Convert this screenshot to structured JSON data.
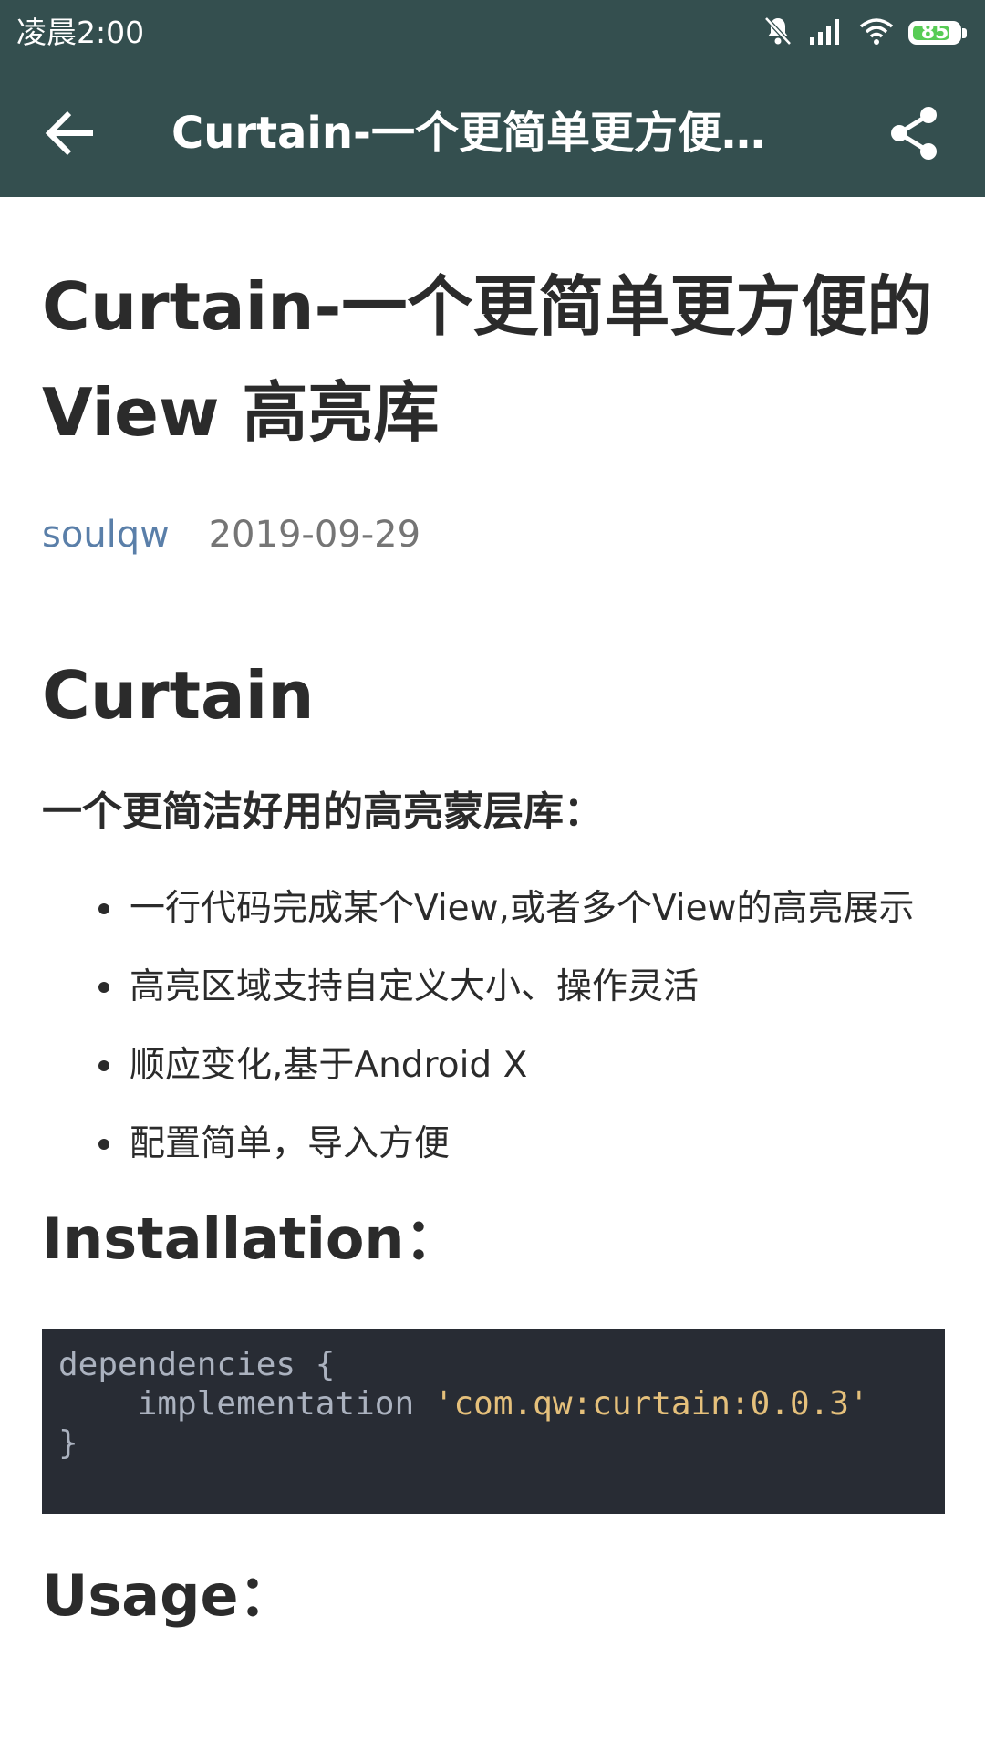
{
  "status_bar": {
    "time": "凌晨2:00",
    "battery_level": 85,
    "battery_text": "85",
    "icons": [
      "mute-bell-icon",
      "signal-icon",
      "wifi-icon",
      "battery-icon"
    ]
  },
  "app_bar": {
    "title": "Curtain-一个更简单更方便…",
    "background_color": "#344f4f",
    "icons": [
      "back-arrow-icon",
      "share-icon"
    ]
  },
  "article": {
    "title": "Curtain-一个更简单更方便的View 高亮库",
    "author": "soulqw",
    "date": "2019-09-29",
    "heading": "Curtain",
    "subheading": "一个更简洁好用的高亮蒙层库：",
    "features": [
      "一行代码完成某个View,或者多个View的高亮展示",
      "高亮区域支持自定义大小、操作灵活",
      "顺应变化,基于Android X",
      "配置简单，导入方便"
    ],
    "installation_heading": "Installation：",
    "code": {
      "line1": "dependencies {",
      "line2_keyword": "    implementation ",
      "line2_string": "'com.qw:curtain:0.0.3'",
      "line3": "}"
    },
    "usage_heading": "Usage："
  },
  "colors": {
    "author_link": "#5a7fa9",
    "text": "#2b2b2b",
    "code_background": "#282c34",
    "code_string": "#e5c07b"
  }
}
